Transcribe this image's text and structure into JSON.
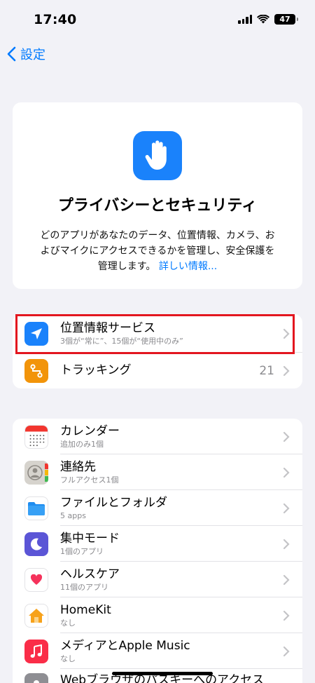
{
  "status_bar": {
    "time": "17:40",
    "battery": "47"
  },
  "nav": {
    "back_label": "設定"
  },
  "hero": {
    "title": "プライバシーとセキュリティ",
    "description": "どのアプリがあなたのデータ、位置情報、カメラ、およびマイクにアクセスできるかを管理し、安全保護を管理します。",
    "link": "詳しい情報..."
  },
  "group1": [
    {
      "title": "位置情報サービス",
      "subtitle": "3個が“常に”、15個が“使用中のみ”",
      "icon": "location-arrow-icon",
      "color": "#1a82fb"
    },
    {
      "title": "トラッキング",
      "value": "21",
      "icon": "tracking-icon",
      "color": "#f2940a"
    }
  ],
  "group2": [
    {
      "title": "カレンダー",
      "subtitle": "追加のみ1個",
      "icon": "calendar-icon"
    },
    {
      "title": "連絡先",
      "subtitle": "フルアクセス1個",
      "icon": "contacts-icon"
    },
    {
      "title": "ファイルとフォルダ",
      "subtitle": "5 apps",
      "icon": "folder-icon"
    },
    {
      "title": "集中モード",
      "subtitle": "1個のアプリ",
      "icon": "moon-icon"
    },
    {
      "title": "ヘルスケア",
      "subtitle": "11個のアプリ",
      "icon": "heart-icon"
    },
    {
      "title": "HomeKit",
      "subtitle": "なし",
      "icon": "home-icon"
    },
    {
      "title": "メディアとApple Music",
      "subtitle": "なし",
      "icon": "music-icon"
    },
    {
      "title": "Webブラウザのパスキーへのアクセス",
      "subtitle": "",
      "icon": "passkey-icon"
    }
  ],
  "colors": {
    "accent": "#007aff",
    "highlight_border": "#e3161f"
  }
}
